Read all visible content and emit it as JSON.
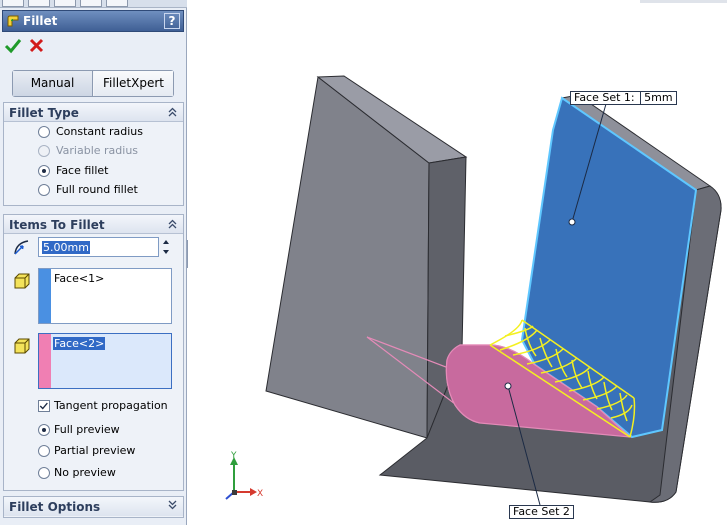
{
  "panel": {
    "title": "Fillet",
    "help_label": "?",
    "mode_tabs": [
      "Manual",
      "FilletXpert"
    ],
    "active_mode": "Manual"
  },
  "fillet_type": {
    "header": "Fillet Type",
    "options": [
      "Constant radius",
      "Variable radius",
      "Face fillet",
      "Full round fillet"
    ],
    "selected": "Face fillet",
    "disabled": [
      "Variable radius"
    ]
  },
  "items_to_fillet": {
    "header": "Items To Fillet",
    "radius_value": "5.00mm",
    "face_set_1": "Face<1>",
    "face_set_2": "Face<2>",
    "tangent_propagation_label": "Tangent propagation",
    "tangent_propagation_checked": true,
    "preview_options": [
      "Full preview",
      "Partial preview",
      "No preview"
    ],
    "preview_selected": "Full preview"
  },
  "fillet_options": {
    "header": "Fillet Options"
  },
  "viewport": {
    "callout_1_name": "Face Set 1:",
    "callout_1_value": "5mm",
    "callout_2": "Face Set 2",
    "triad_y": "Y",
    "triad_x": "X"
  },
  "colors": {
    "face_set_1": "#3f78c7",
    "face_set_2": "#d977a8",
    "fillet_preview": "#ffff33",
    "part_body": "#6f717a"
  }
}
